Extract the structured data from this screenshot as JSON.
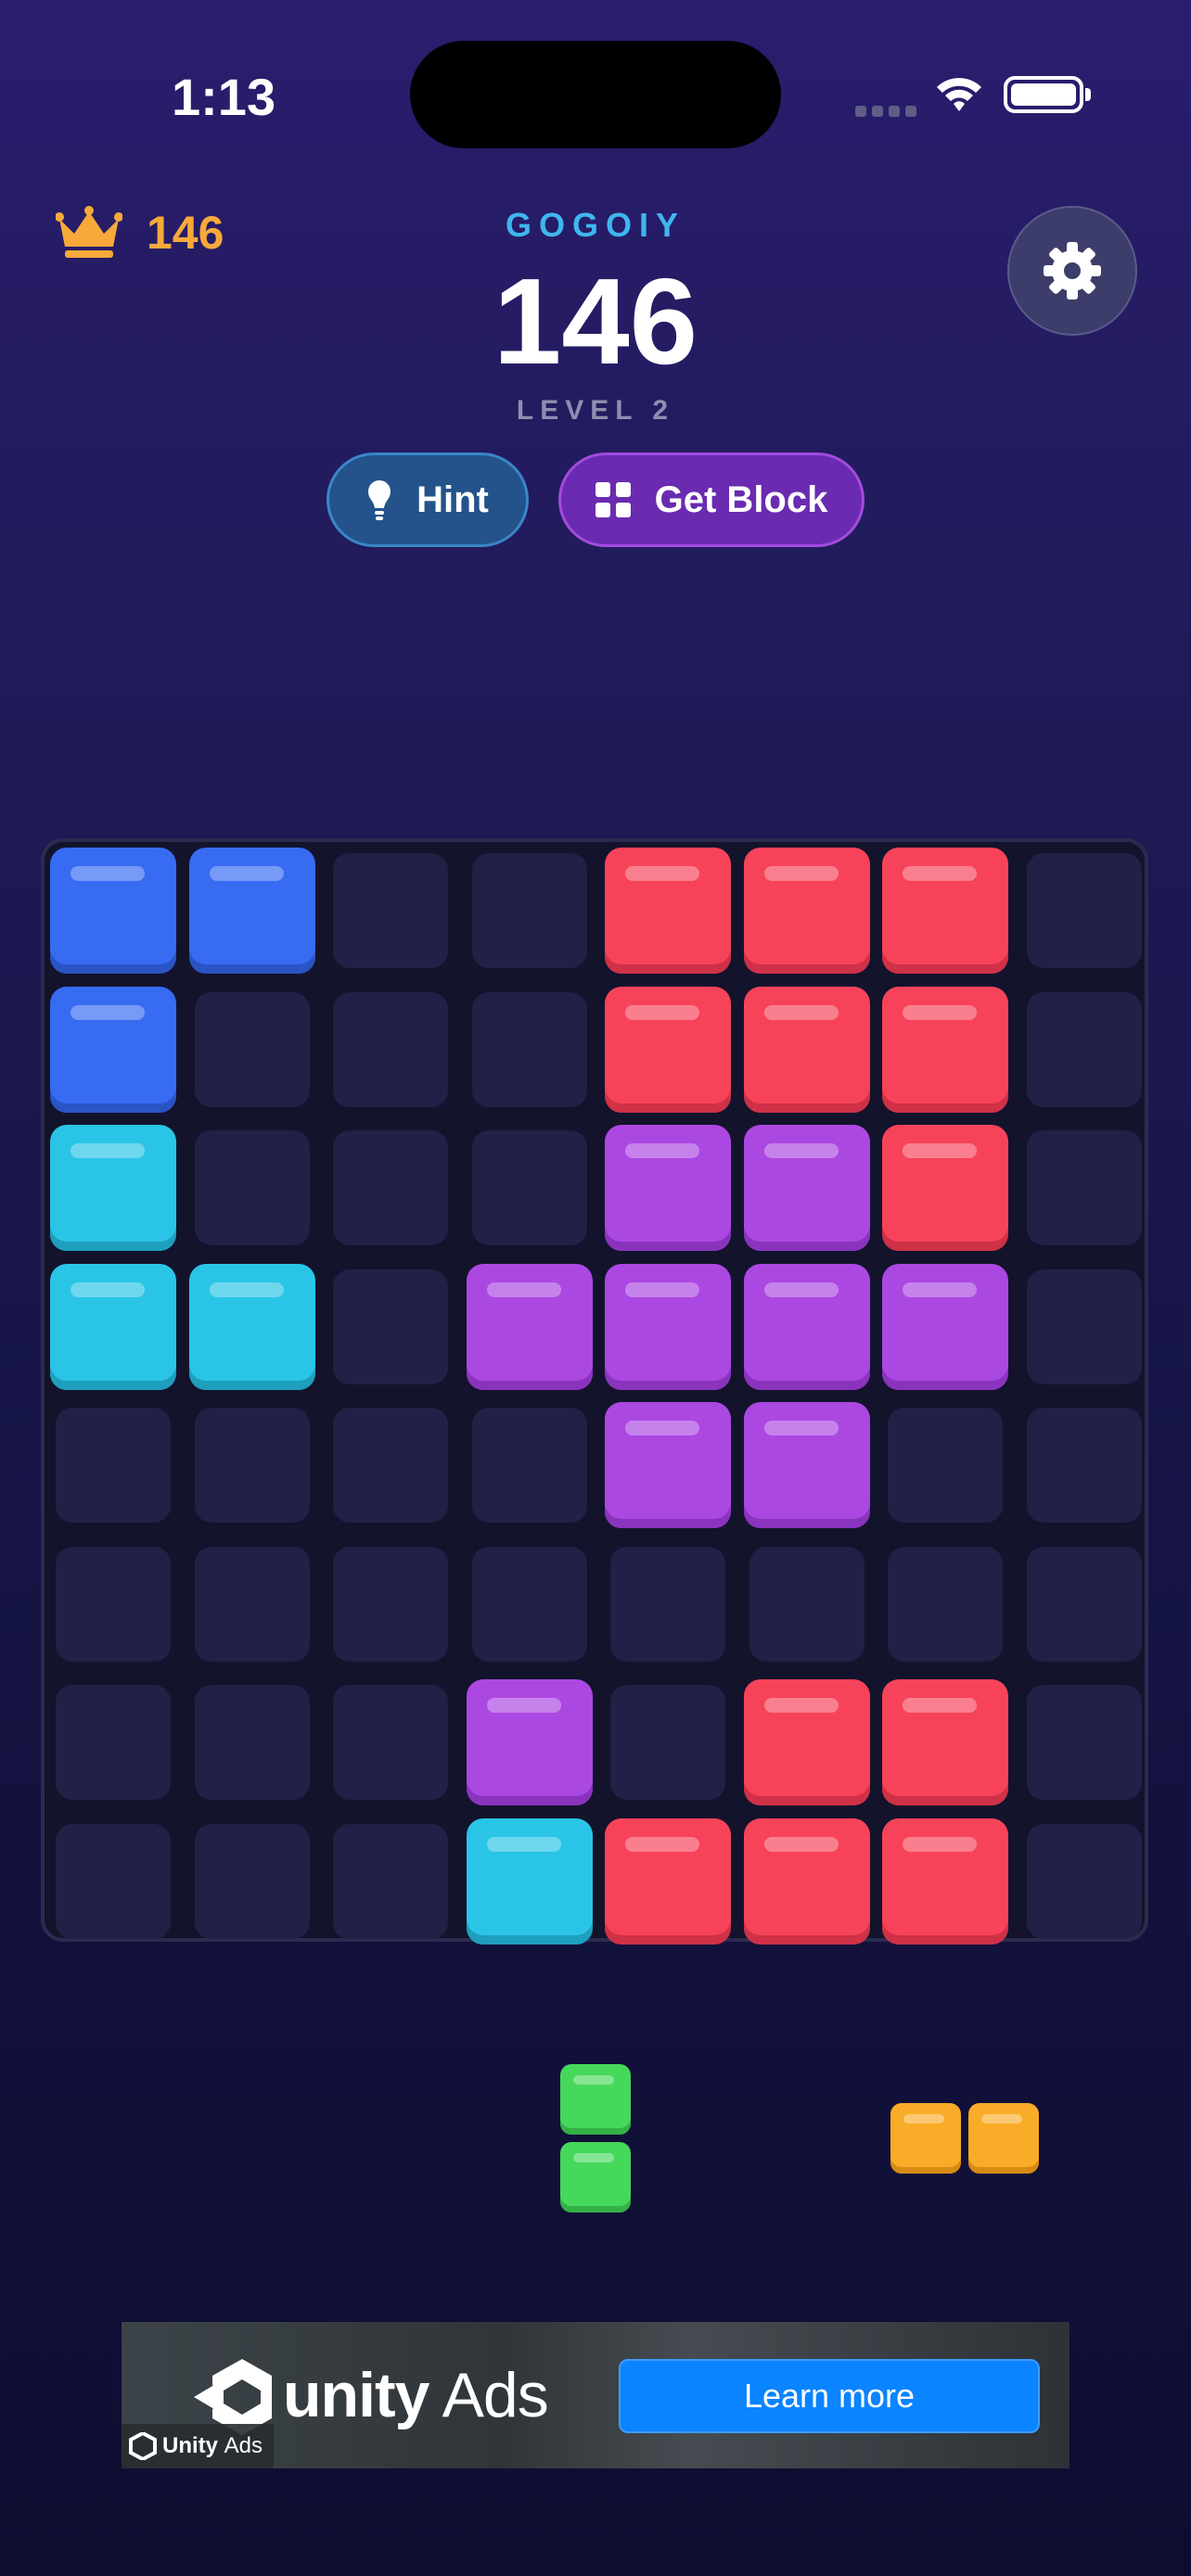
{
  "status_bar": {
    "time": "1:13"
  },
  "header": {
    "best_score": "146",
    "player_name": "GOGOIY",
    "score": "146",
    "level": "LEVEL 2"
  },
  "buttons": {
    "hint": "Hint",
    "get_block": "Get Block"
  },
  "board": {
    "rows": 8,
    "cols": 8,
    "grid": [
      [
        "blue",
        "blue",
        null,
        null,
        "red",
        "red",
        "red",
        null
      ],
      [
        "blue",
        null,
        null,
        null,
        "red",
        "red",
        "red",
        null
      ],
      [
        "cyan",
        null,
        null,
        null,
        "purple",
        "purple",
        "red",
        null
      ],
      [
        "cyan",
        "cyan",
        null,
        "purple",
        "purple",
        "purple",
        "purple",
        null
      ],
      [
        null,
        null,
        null,
        null,
        "purple",
        "purple",
        null,
        null
      ],
      [
        null,
        null,
        null,
        null,
        null,
        null,
        null,
        null
      ],
      [
        null,
        null,
        null,
        "purple",
        null,
        "red",
        "red",
        null
      ],
      [
        null,
        null,
        null,
        "cyan",
        "red",
        "red",
        "red",
        null
      ]
    ]
  },
  "pieces": [
    {
      "color": "green",
      "shape": [
        [
          1
        ],
        [
          1
        ]
      ]
    },
    {
      "color": "orange",
      "shape": [
        [
          1,
          1
        ]
      ]
    }
  ],
  "colors": {
    "blue": "#376bf2",
    "red": "#f7435a",
    "cyan": "#2ac5e6",
    "purple": "#ac48e2",
    "green": "#46d85a",
    "orange": "#f9ac27",
    "accent_gold": "#f7a93a",
    "accent_cyan": "#3fb6ee"
  },
  "ad": {
    "brand": "unity",
    "brand_suffix": "Ads",
    "cta": "Learn more",
    "badge_brand": "Unity",
    "badge_suffix": "Ads"
  }
}
